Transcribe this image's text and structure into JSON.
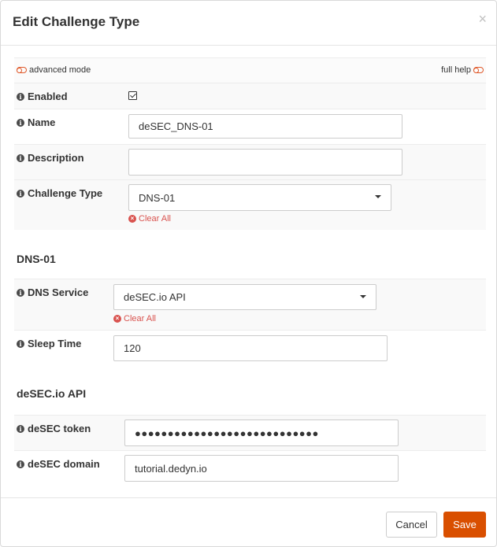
{
  "dialog": {
    "title": "Edit Challenge Type",
    "close_symbol": "×"
  },
  "toggles": {
    "advanced_mode_label": "advanced mode",
    "full_help_label": "full help"
  },
  "general": {
    "enabled": {
      "label": "Enabled",
      "checked": true
    },
    "name": {
      "label": "Name",
      "value": "deSEC_DNS-01"
    },
    "description": {
      "label": "Description",
      "value": ""
    },
    "challenge_type": {
      "label": "Challenge Type",
      "value": "DNS-01",
      "clear_label": "Clear All"
    }
  },
  "dns01": {
    "section_title": "DNS-01",
    "dns_service": {
      "label": "DNS Service",
      "value": "deSEC.io API",
      "clear_label": "Clear All"
    },
    "sleep_time": {
      "label": "Sleep Time",
      "value": "120"
    }
  },
  "desec": {
    "section_title": "deSEC.io API",
    "token": {
      "label": "deSEC token",
      "masked_value": "●●●●●●●●●●●●●●●●●●●●●●●●●●●●"
    },
    "domain": {
      "label": "deSEC domain",
      "value": "tutorial.dedyn.io"
    }
  },
  "footer": {
    "cancel_label": "Cancel",
    "save_label": "Save"
  },
  "colors": {
    "accent": "#d94f00",
    "danger": "#d9534f"
  },
  "icons": {
    "info": "info-icon",
    "clear": "clear-x-icon",
    "toggle": "toggle-icon"
  }
}
